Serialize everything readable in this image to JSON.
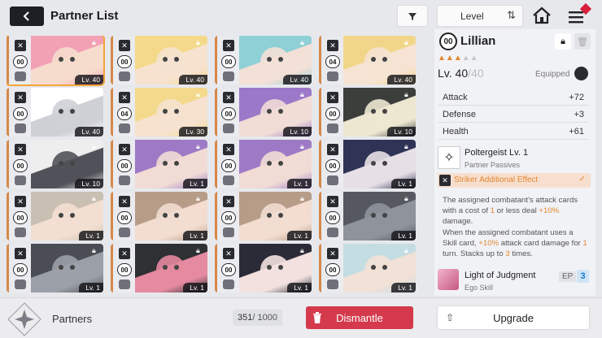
{
  "header": {
    "title": "Partner List",
    "sort_label": "Level",
    "back_icon": "back-arrow-icon",
    "filter_icon": "funnel-icon",
    "sort_icon": "sort-toggle-icon",
    "home_icon": "home-icon",
    "menu_icon": "hamburger-menu-icon"
  },
  "cards": [
    {
      "num": "00",
      "lv": "Lv. 40",
      "hair": "#f2a1b5",
      "skin": "#f6dccd",
      "selected": true
    },
    {
      "num": "00",
      "lv": "Lv. 40",
      "hair": "#f3d989",
      "skin": "#f6e2cf"
    },
    {
      "num": "00",
      "lv": "Lv. 40",
      "hair": "#8fd0d6",
      "skin": "#f3e0d6"
    },
    {
      "num": "04",
      "lv": "Lv. 40",
      "hair": "#f1d68a",
      "skin": "#f6e3d3"
    },
    {
      "num": "00",
      "lv": "Lv. 40",
      "hair": "#ffffff",
      "skin": "#cfd0d6"
    },
    {
      "num": "04",
      "lv": "Lv. 30",
      "hair": "#f3d98b",
      "skin": "#f6e2cf"
    },
    {
      "num": "00",
      "lv": "Lv. 10",
      "hair": "#9b78c8",
      "skin": "#f1dcd6"
    },
    {
      "num": "00",
      "lv": "Lv. 10",
      "hair": "#3b3e3b",
      "skin": "#ede7d2"
    },
    {
      "num": "00",
      "lv": "Lv. 10",
      "hair": "#eeeeee",
      "skin": "#515259"
    },
    {
      "num": "00",
      "lv": "Lv. 1",
      "hair": "#9e7ac6",
      "skin": "#f1dbd5"
    },
    {
      "num": "00",
      "lv": "Lv. 1",
      "hair": "#9e7ac6",
      "skin": "#f1dbd5"
    },
    {
      "num": "00",
      "lv": "Lv. 1",
      "hair": "#2f3356",
      "skin": "#e7dfe6"
    },
    {
      "num": "00",
      "lv": "Lv. 1",
      "hair": "#c9c0b3",
      "skin": "#f3dfd2"
    },
    {
      "num": "00",
      "lv": "Lv. 1",
      "hair": "#b79c88",
      "skin": "#f2ddd0"
    },
    {
      "num": "00",
      "lv": "Lv. 1",
      "hair": "#b79c88",
      "skin": "#f2ddd0"
    },
    {
      "num": "00",
      "lv": "Lv. 1",
      "hair": "#55585f",
      "skin": "#8f949c"
    },
    {
      "num": "00",
      "lv": "Lv. 1",
      "hair": "#4a4d53",
      "skin": "#9ba0a8"
    },
    {
      "num": "00",
      "lv": "Lv. 1",
      "hair": "#2e3033",
      "skin": "#e58aa0"
    },
    {
      "num": "00",
      "lv": "Lv. 1",
      "hair": "#2b2b38",
      "skin": "#f3e1df"
    },
    {
      "num": "00",
      "lv": "Lv. 1",
      "hair": "#c3dde3",
      "skin": "#f2e1d6"
    }
  ],
  "detail": {
    "num": "00",
    "name": "Lillian",
    "stars_filled": 3,
    "stars_total": 5,
    "level": "Lv. 40",
    "level_max": "/40",
    "equipped_label": "Equipped",
    "stats": [
      {
        "label": "Attack",
        "value": "+72"
      },
      {
        "label": "Defense",
        "value": "+3"
      },
      {
        "label": "Health",
        "value": "+61"
      }
    ],
    "passive_name": "Poltergeist Lv. 1",
    "passive_type": "Partner Passives",
    "striker_label": "Striker Additional Effect",
    "desc_1": "The assigned combatant's attack cards with a cost of ",
    "desc_2": "1",
    "desc_3": " or less deal ",
    "desc_4": "+10%",
    "desc_5": " damage.",
    "desc_6": "When the assigned combatant uses a Skill card, ",
    "desc_7": "+10%",
    "desc_8": " attack card damage for ",
    "desc_9": "1",
    "desc_10": " turn. Stacks up to ",
    "desc_11": "3",
    "desc_12": " times.",
    "ego_name": "Light of Judgment",
    "ego_type": "Ego Skill",
    "ep_label": "EP",
    "ep_value": "3"
  },
  "footer": {
    "title": "Partners",
    "count_current": "351",
    "count_max": " / 1000",
    "dismantle_label": "Dismantle",
    "upgrade_label": "Upgrade"
  },
  "colors": {
    "accent": "#e2862f",
    "danger": "#d43a4c",
    "selected_outline": "#f3a43a"
  }
}
